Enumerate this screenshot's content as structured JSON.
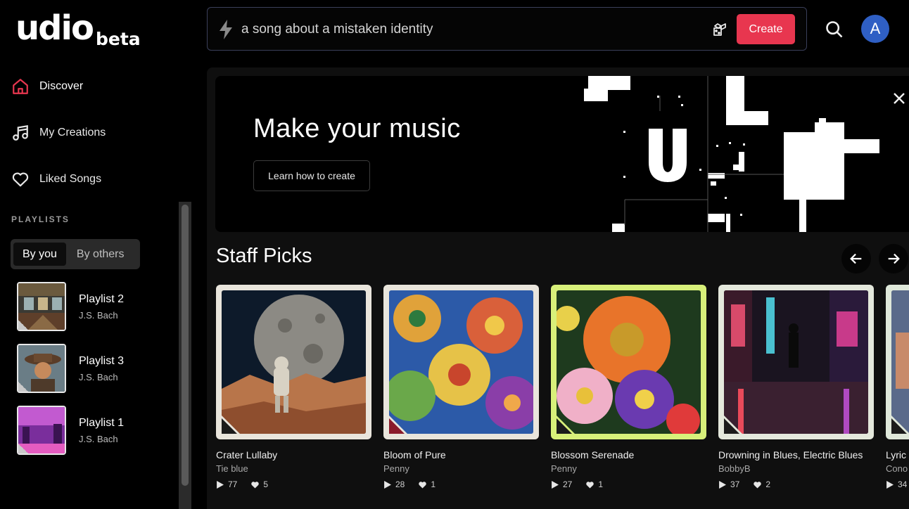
{
  "brand": {
    "wordmark": "udio",
    "badge": "beta"
  },
  "nav": [
    {
      "label": "Discover",
      "icon": "home-icon"
    },
    {
      "label": "My Creations",
      "icon": "music-note-icon"
    },
    {
      "label": "Liked Songs",
      "icon": "heart-icon"
    }
  ],
  "playlists": {
    "heading": "PLAYLISTS",
    "tabs": [
      "By you",
      "By others"
    ],
    "selected_tab": "By you",
    "items": [
      {
        "title": "Playlist 2",
        "owner": "J.S. Bach"
      },
      {
        "title": "Playlist 3",
        "owner": "J.S. Bach"
      },
      {
        "title": "Playlist 1",
        "owner": "J.S. Bach"
      }
    ]
  },
  "search": {
    "value": "a song about a mistaken identity",
    "create_label": "Create"
  },
  "user": {
    "avatar_letter": "A"
  },
  "hero": {
    "title": "Make your music",
    "button": "Learn how to create"
  },
  "staff_picks": {
    "title": "Staff Picks",
    "cards": [
      {
        "title": "Crater Lullaby",
        "artist": "Tie blue",
        "plays": "77",
        "likes": "5",
        "frame_color": "#e9e5dc"
      },
      {
        "title": "Bloom of Pure",
        "artist": "Penny",
        "plays": "28",
        "likes": "1",
        "frame_color": "#e9e5dc"
      },
      {
        "title": "Blossom Serenade",
        "artist": "Penny",
        "plays": "27",
        "likes": "1",
        "frame_color": "#d8f07a"
      },
      {
        "title": "Drowning in Blues, Electric Blues",
        "artist": "BobbyB",
        "plays": "37",
        "likes": "2",
        "frame_color": "#e4e8dc"
      },
      {
        "title": "Lyric",
        "artist": "Cono",
        "plays": "34",
        "likes": "",
        "frame_color": "#dfe8da"
      }
    ]
  },
  "colors": {
    "accent": "#e8364f",
    "avatar": "#2f5fc4"
  }
}
